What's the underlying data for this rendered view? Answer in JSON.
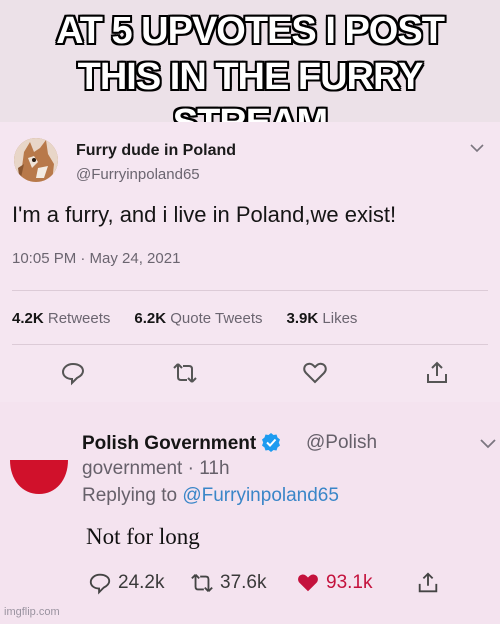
{
  "meme": {
    "caption_line1": "AT 5 UPVOTES I POST",
    "caption_line2": "THIS IN THE FURRY STREAM",
    "watermark": "imgflip.com"
  },
  "tweet": {
    "display_name": "Furry dude in Poland",
    "handle": "@Furryinpoland65",
    "text": "I'm a furry, and i live in Poland,we exist!",
    "timestamp": "10:05 PM · May 24, 2021",
    "stats": {
      "retweets_count": "4.2K",
      "retweets_label": "Retweets",
      "quotes_count": "6.2K",
      "quotes_label": "Quote Tweets",
      "likes_count": "3.9K",
      "likes_label": "Likes"
    },
    "icons": [
      "chat-bubble-icon",
      "retweet-icon",
      "heart-icon",
      "share-icon"
    ]
  },
  "reply": {
    "display_name": "Polish Government",
    "handle_part1": "@Polish",
    "handle_part2": "government",
    "time": "· 11h",
    "replying_prefix": "Replying to",
    "replying_handle": "@Furryinpoland65",
    "text": "Not for long",
    "counts": {
      "replies": "24.2k",
      "retweets": "37.6k",
      "likes": "93.1k"
    },
    "colors": {
      "verified": "#1d9bf0",
      "like": "#c4123d",
      "link": "#3a86c8",
      "flag_red": "#d0112b"
    }
  }
}
